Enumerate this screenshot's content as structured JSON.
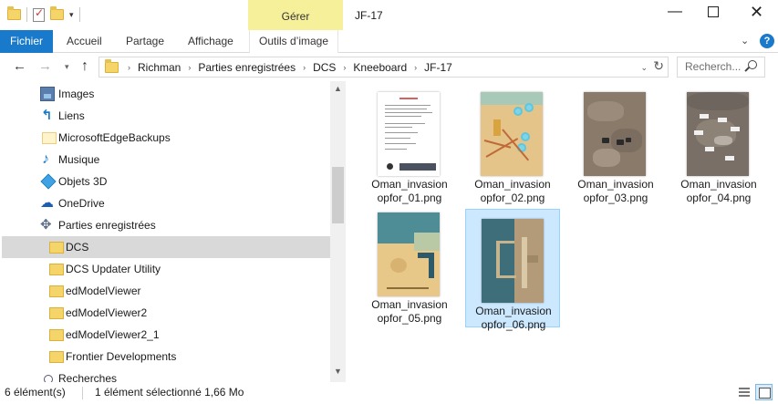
{
  "window": {
    "title": "JF-17",
    "contextual_tab": "Gérer",
    "minimize_icon": "minimize-icon",
    "maximize_icon": "maximize-icon",
    "close_icon": "close-icon"
  },
  "ribbon": {
    "tabs": [
      "Fichier",
      "Accueil",
      "Partage",
      "Affichage",
      "Outils d’image"
    ],
    "help_glyph": "?"
  },
  "address": {
    "breadcrumb": [
      "Richman",
      "Parties enregistrées",
      "DCS",
      "Kneeboard",
      "JF-17"
    ],
    "search_placeholder": "Recherch..."
  },
  "nav_pane": {
    "items": [
      {
        "label": "Images",
        "icon": "images-icon"
      },
      {
        "label": "Liens",
        "icon": "links-icon"
      },
      {
        "label": "MicrosoftEdgeBackups",
        "icon": "folder-icon"
      },
      {
        "label": "Musique",
        "icon": "music-icon"
      },
      {
        "label": "Objets 3D",
        "icon": "3d-objects-icon"
      },
      {
        "label": "OneDrive",
        "icon": "onedrive-icon"
      },
      {
        "label": "Parties enregistrées",
        "icon": "saved-games-icon"
      },
      {
        "label": "DCS",
        "icon": "folder-icon",
        "selected": true
      },
      {
        "label": "DCS Updater Utility",
        "icon": "folder-icon"
      },
      {
        "label": "edModelViewer",
        "icon": "folder-icon"
      },
      {
        "label": "edModelViewer2",
        "icon": "folder-icon"
      },
      {
        "label": "edModelViewer2_1",
        "icon": "folder-icon"
      },
      {
        "label": "Frontier Developments",
        "icon": "folder-icon"
      },
      {
        "label": "Recherches",
        "icon": "searches-icon"
      }
    ]
  },
  "files": [
    {
      "name_line1": "Oman_invasion",
      "name_line2": "opfor_01.png",
      "thumb": "document"
    },
    {
      "name_line1": "Oman_invasion",
      "name_line2": "opfor_02.png",
      "thumb": "map"
    },
    {
      "name_line1": "Oman_invasion",
      "name_line2": "opfor_03.png",
      "thumb": "desert"
    },
    {
      "name_line1": "Oman_invasion",
      "name_line2": "opfor_04.png",
      "thumb": "desert-tagged"
    },
    {
      "name_line1": "Oman_invasion",
      "name_line2": "opfor_05.png",
      "thumb": "coast"
    },
    {
      "name_line1": "Oman_invasion",
      "name_line2": "opfor_06.png",
      "thumb": "harbor",
      "selected": true
    }
  ],
  "status": {
    "count": "6 élément(s)",
    "selection": "1 élément sélectionné  1,66 Mo"
  },
  "colors": {
    "accent": "#1979ca",
    "contextual_tab_bg": "#f7f09a",
    "selection_bg": "#cce8ff"
  }
}
